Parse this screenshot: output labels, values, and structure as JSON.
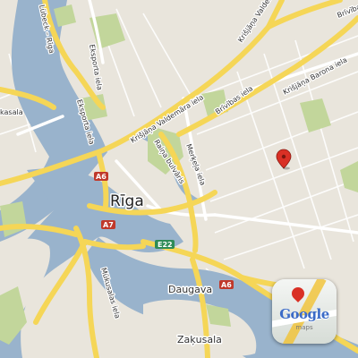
{
  "map": {
    "city_label": "Rīga",
    "districts": {
      "daugava": "Daugava",
      "zakusala": "Zaķusala"
    },
    "streets": {
      "lubeck": "Lübeck – Rīga",
      "eksporta_top": "Eksporta iela",
      "eksporta_left": "Eksporta iela",
      "valdemara_upper": "Krišjāņa Valdemāra iela",
      "valdemara_lower": "Krišjāņa Valdemāra iela",
      "raina": "Raiņa bulvāris",
      "merkela": "Merķeļa iela",
      "brivibas_mid": "Brīvības iela",
      "brivibas_top": "Brīvība",
      "barona": "Krišjāņa Barona iela",
      "mukusalas": "Mūkusalas iela",
      "kasala": "kasala"
    },
    "road_shields": [
      "A6",
      "A7",
      "E22",
      "A6"
    ],
    "colors": {
      "land": "#e9e5dc",
      "water": "#99b3cc",
      "park": "#c2d69b",
      "major_road": "#f5d657",
      "road": "#ffffff",
      "marker": "#d93025",
      "shield_red": "#c0392b",
      "shield_green": "#2e8b57"
    }
  },
  "badge": {
    "logo_text": "Google",
    "sub_text": "maps"
  },
  "marker": {
    "icon": "map-pin-icon"
  }
}
